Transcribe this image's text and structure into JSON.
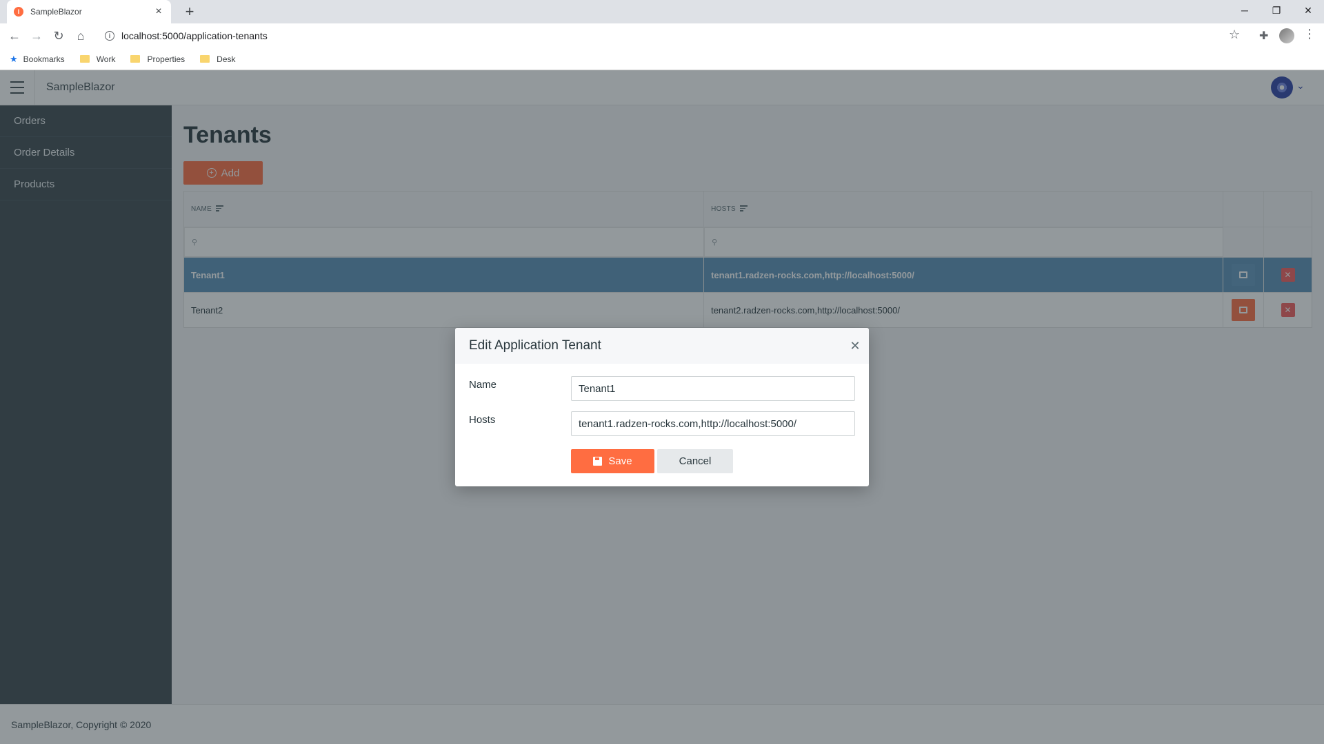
{
  "browser": {
    "tab_title": "SampleBlazor",
    "favicon_letter": "I",
    "url": "localhost:5000/application-tenants",
    "bookmarks": [
      {
        "label": "Bookmarks",
        "icon": "star-icon"
      },
      {
        "label": "Work",
        "icon": "folder-icon"
      },
      {
        "label": "Properties",
        "icon": "folder-icon"
      },
      {
        "label": "Desk",
        "icon": "folder-icon"
      }
    ]
  },
  "app": {
    "title": "SampleBlazor",
    "sidebar": {
      "items": [
        {
          "label": "Orders"
        },
        {
          "label": "Order Details"
        },
        {
          "label": "Products"
        }
      ]
    },
    "page_title": "Tenants",
    "add_button": "Add",
    "grid": {
      "columns": [
        "NAME",
        "HOSTS"
      ],
      "rows": [
        {
          "name": "Tenant1",
          "hosts": "tenant1.radzen-rocks.com,http://localhost:5000/",
          "selected": true
        },
        {
          "name": "Tenant2",
          "hosts": "tenant2.radzen-rocks.com,http://localhost:5000/",
          "selected": false
        }
      ]
    },
    "footer": "SampleBlazor, Copyright © 2020"
  },
  "dialog": {
    "title": "Edit Application Tenant",
    "fields": [
      {
        "label": "Name",
        "value": "Tenant1"
      },
      {
        "label": "Hosts",
        "value": "tenant1.radzen-rocks.com,http://localhost:5000/"
      }
    ],
    "save_label": "Save",
    "cancel_label": "Cancel"
  },
  "colors": {
    "accent": "#ff6d41",
    "sidebar": "#3a474d",
    "selected_row": "#598fb7",
    "danger": "#f45a5a"
  }
}
